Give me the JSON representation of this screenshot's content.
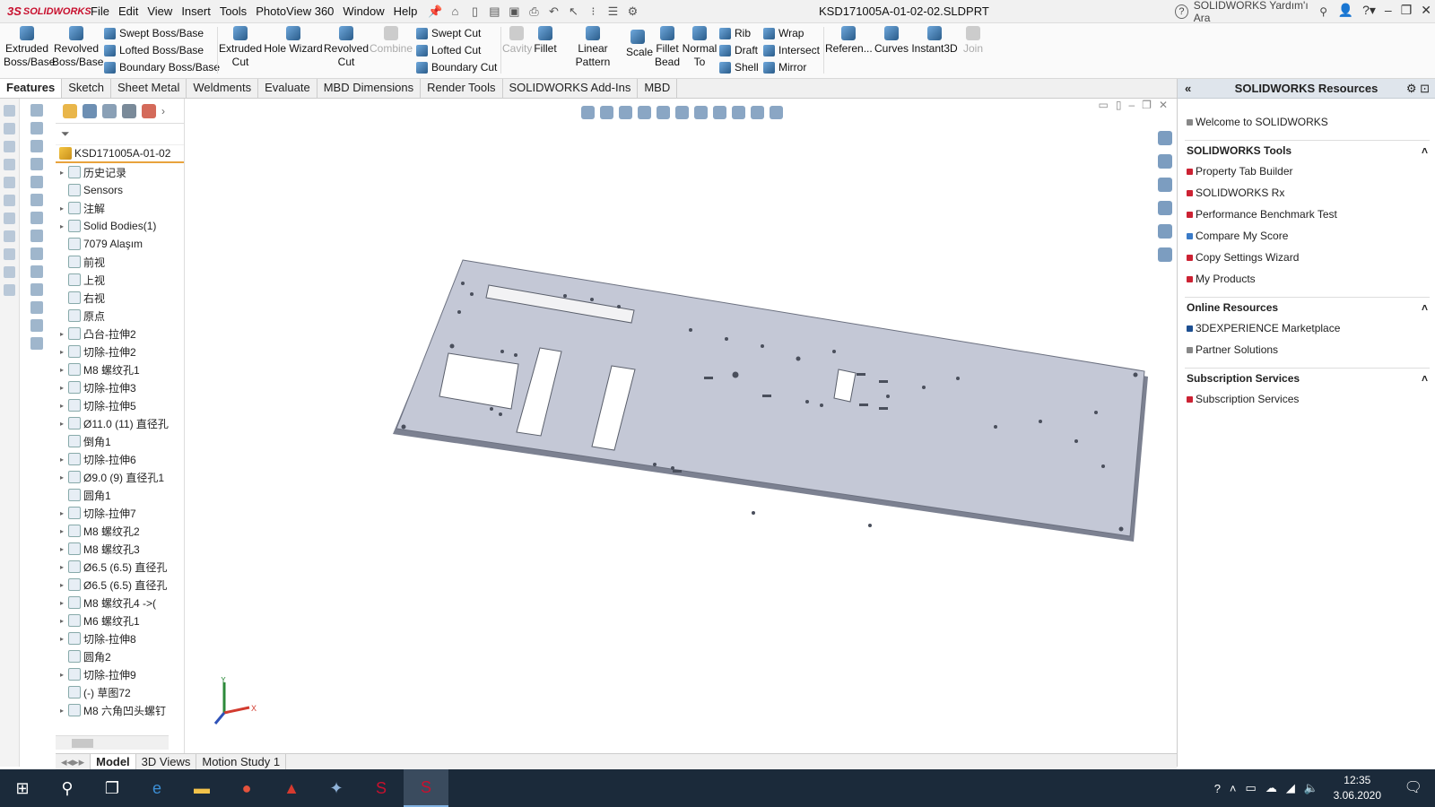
{
  "app": {
    "logo": "SOLIDWORKS",
    "doc_title": "KSD171005A-01-02-02.SLDPRT",
    "search_placeholder": "SOLIDWORKS Yardım'ı Ara"
  },
  "menu": [
    "File",
    "Edit",
    "View",
    "Insert",
    "Tools",
    "PhotoView 360",
    "Window",
    "Help"
  ],
  "toolbar": {
    "extruded_boss": "Extruded Boss/Base",
    "revolved_boss": "Revolved Boss/Base",
    "swept_boss": "Swept Boss/Base",
    "lofted_boss": "Lofted Boss/Base",
    "boundary_boss": "Boundary Boss/Base",
    "extruded_cut": "Extruded Cut",
    "hole_wizard": "Hole Wizard",
    "revolved_cut": "Revolved Cut",
    "combine": "Combine",
    "swept_cut": "Swept Cut",
    "lofted_cut": "Lofted Cut",
    "boundary_cut": "Boundary Cut",
    "cavity": "Cavity",
    "fillet": "Fillet",
    "linear_pattern": "Linear Pattern",
    "scale": "Scale",
    "fillet_bead": "Fillet Bead",
    "normal_to": "Normal To",
    "rib": "Rib",
    "draft": "Draft",
    "shell": "Shell",
    "wrap": "Wrap",
    "intersect": "Intersect",
    "mirror": "Mirror",
    "reference": "Referen...",
    "curves": "Curves",
    "instant3d": "Instant3D",
    "join": "Join"
  },
  "tabs": [
    "Features",
    "Sketch",
    "Sheet Metal",
    "Weldments",
    "Evaluate",
    "MBD Dimensions",
    "Render Tools",
    "SOLIDWORKS Add-Ins",
    "MBD"
  ],
  "tree": {
    "root": "KSD171005A-01-02",
    "items": [
      "历史记录",
      "Sensors",
      "注解",
      "Solid Bodies(1)",
      "7079 Alaşım",
      "前视",
      "上视",
      "右视",
      "原点",
      "凸台-拉伸2",
      "切除-拉伸2",
      "M8 螺纹孔1",
      "切除-拉伸3",
      "切除-拉伸5",
      "Ø11.0 (11) 直径孔",
      "倒角1",
      "切除-拉伸6",
      "Ø9.0 (9) 直径孔1",
      "圆角1",
      "切除-拉伸7",
      "M8 螺纹孔2",
      "M8 螺纹孔3",
      "Ø6.5 (6.5) 直径孔",
      "Ø6.5 (6.5) 直径孔",
      "M8 螺纹孔4 ->(",
      "M6 螺纹孔1",
      "切除-拉伸8",
      "圆角2",
      "切除-拉伸9",
      "(-) 草图72",
      "M8 六角凹头螺钉"
    ]
  },
  "bottom_tabs": [
    "Model",
    "3D Views",
    "Motion Study 1"
  ],
  "task_pane": {
    "title": "SOLIDWORKS Resources",
    "welcome": "Welcome to SOLIDWORKS",
    "tools_title": "SOLIDWORKS Tools",
    "tools": [
      "Property Tab Builder",
      "SOLIDWORKS Rx",
      "Performance Benchmark Test",
      "Compare My Score",
      "Copy Settings Wizard",
      "My Products"
    ],
    "online_title": "Online Resources",
    "online": [
      "3DEXPERIENCE Marketplace",
      "Partner Solutions"
    ],
    "sub_title": "Subscription Services",
    "sub": [
      "Subscription Services"
    ]
  },
  "taskbar": {
    "time": "12:35",
    "date": "3.06.2020"
  },
  "colors": {
    "accent": "#c8102e",
    "part": "#c4c8d6",
    "taskbar": "#1b2a3a"
  }
}
